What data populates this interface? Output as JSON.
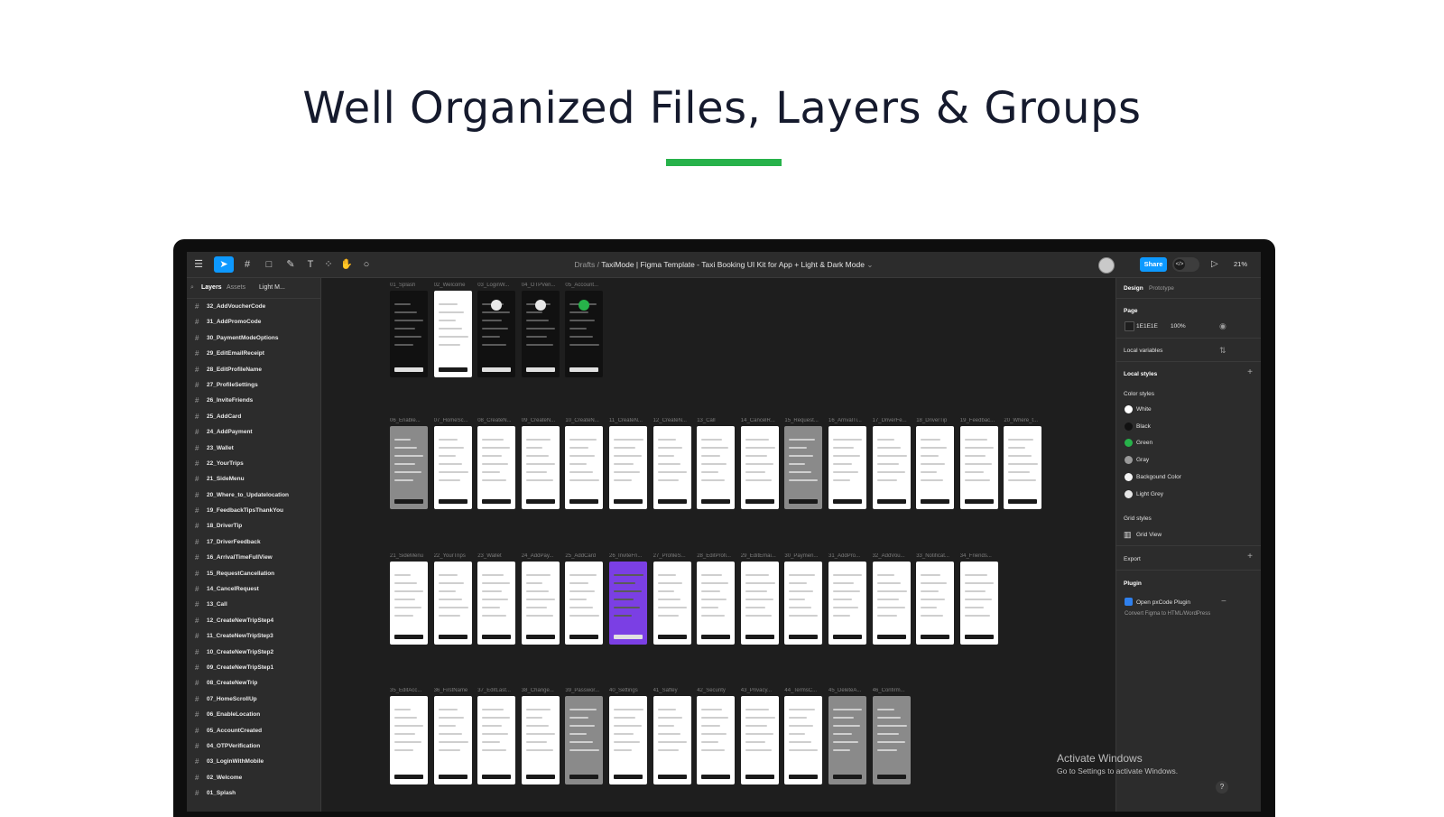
{
  "hero": {
    "title": "Well Organized Files, Layers & Groups",
    "accent_color": "#27b24a"
  },
  "toolbar": {
    "icons": [
      "figma-menu-icon",
      "move-tool-icon",
      "frame-tool-icon",
      "shape-tool-icon",
      "pen-tool-icon",
      "text-tool-icon",
      "resources-icon",
      "hand-tool-icon",
      "comment-icon"
    ],
    "breadcrumb_drafts": "Drafts",
    "breadcrumb_separator": "/",
    "file_name": "TaxiMode | Figma Template - Taxi Booking UI Kit for App + Light & Dark Mode",
    "share_label": "Share",
    "zoom_label": "21%",
    "accent_color": "#0d99ff"
  },
  "left_panel": {
    "tab_layers": "Layers",
    "tab_assets": "Assets",
    "page_select": "Light M...",
    "layers": [
      "32_AddVoucherCode",
      "31_AddPromoCode",
      "30_PaymentModeOptions",
      "29_EditEmailReceipt",
      "28_EditProfileName",
      "27_ProfileSettings",
      "26_InviteFriends",
      "25_AddCard",
      "24_AddPayment",
      "23_Wallet",
      "22_YourTrips",
      "21_SideMenu",
      "20_Where_to_Updatelocation",
      "19_FeedbackTipsThankYou",
      "18_DriverTip",
      "17_DriverFeedback",
      "16_ArrivalTimeFullView",
      "15_RequestCancellation",
      "14_CancelRequest",
      "13_Call",
      "12_CreateNewTripStep4",
      "11_CreateNewTripStep3",
      "10_CreateNewTripStep2",
      "09_CreateNewTripStep1",
      "08_CreateNewTrip",
      "07_HomeScrollUp",
      "06_EnableLocation",
      "05_AccountCreated",
      "04_OTPVerification",
      "03_LoginWithMobile",
      "02_Welcome",
      "01_Splash"
    ]
  },
  "canvas": {
    "rows": [
      {
        "frames": [
          "01_Splash",
          "02_Welcome",
          "03_LoginW...",
          "04_OTPVeri...",
          "05_Account..."
        ]
      },
      {
        "frames": [
          "06_Enable...",
          "07_HomeSc...",
          "08_CreateN...",
          "09_CreateN...",
          "10_CreateN...",
          "11_CreateN...",
          "12_CreateN...",
          "13_Call",
          "14_CancelR...",
          "15_Request...",
          "16_ArrivalTi...",
          "17_DriverFe...",
          "18_DriverTip",
          "19_Feedbac...",
          "20_Where_t..."
        ]
      },
      {
        "frames": [
          "21_SideMenu",
          "22_YourTrips",
          "23_Wallet",
          "24_AddPay...",
          "25_AddCard",
          "26_InviteFri...",
          "27_ProfileS...",
          "28_EditProfi...",
          "29_EditEmai...",
          "30_Paymen...",
          "31_AddPro...",
          "32_AddVou...",
          "33_Notificat...",
          "34_Friends..."
        ]
      },
      {
        "frames": [
          "35_EditAcc...",
          "36_FirstName",
          "37_EditLast...",
          "38_Change...",
          "39_Passwor...",
          "40_Settings",
          "41_Saftey",
          "42_Security",
          "43_Privacy...",
          "44_TermsC...",
          "45_DeleteA...",
          "46_Confirm..."
        ]
      }
    ]
  },
  "right_panel": {
    "tab_design": "Design",
    "tab_prototype": "Prototype",
    "page_heading": "Page",
    "page_color": "1E1E1E",
    "page_opacity": "100%",
    "local_variables": "Local variables",
    "local_styles": "Local styles",
    "color_styles": "Color styles",
    "colors": [
      {
        "name": "White",
        "hex": "#ffffff"
      },
      {
        "name": "Black",
        "hex": "#111111"
      },
      {
        "name": "Green",
        "hex": "#27b24a"
      },
      {
        "name": "Gray",
        "hex": "#9a9a9a"
      },
      {
        "name": "Backgound Color",
        "hex": "#f5f5f5"
      },
      {
        "name": "Light Grey",
        "hex": "#e6e6e6"
      }
    ],
    "grid_styles": "Grid styles",
    "grid_view": "Grid View",
    "export": "Export",
    "plugin_heading": "Plugin",
    "plugin_name": "Open pxCode Plugin",
    "plugin_desc": "Convert Figma to HTML/WordPress"
  },
  "windows_notice": {
    "title": "Activate Windows",
    "subtitle": "Go to Settings to activate Windows."
  }
}
